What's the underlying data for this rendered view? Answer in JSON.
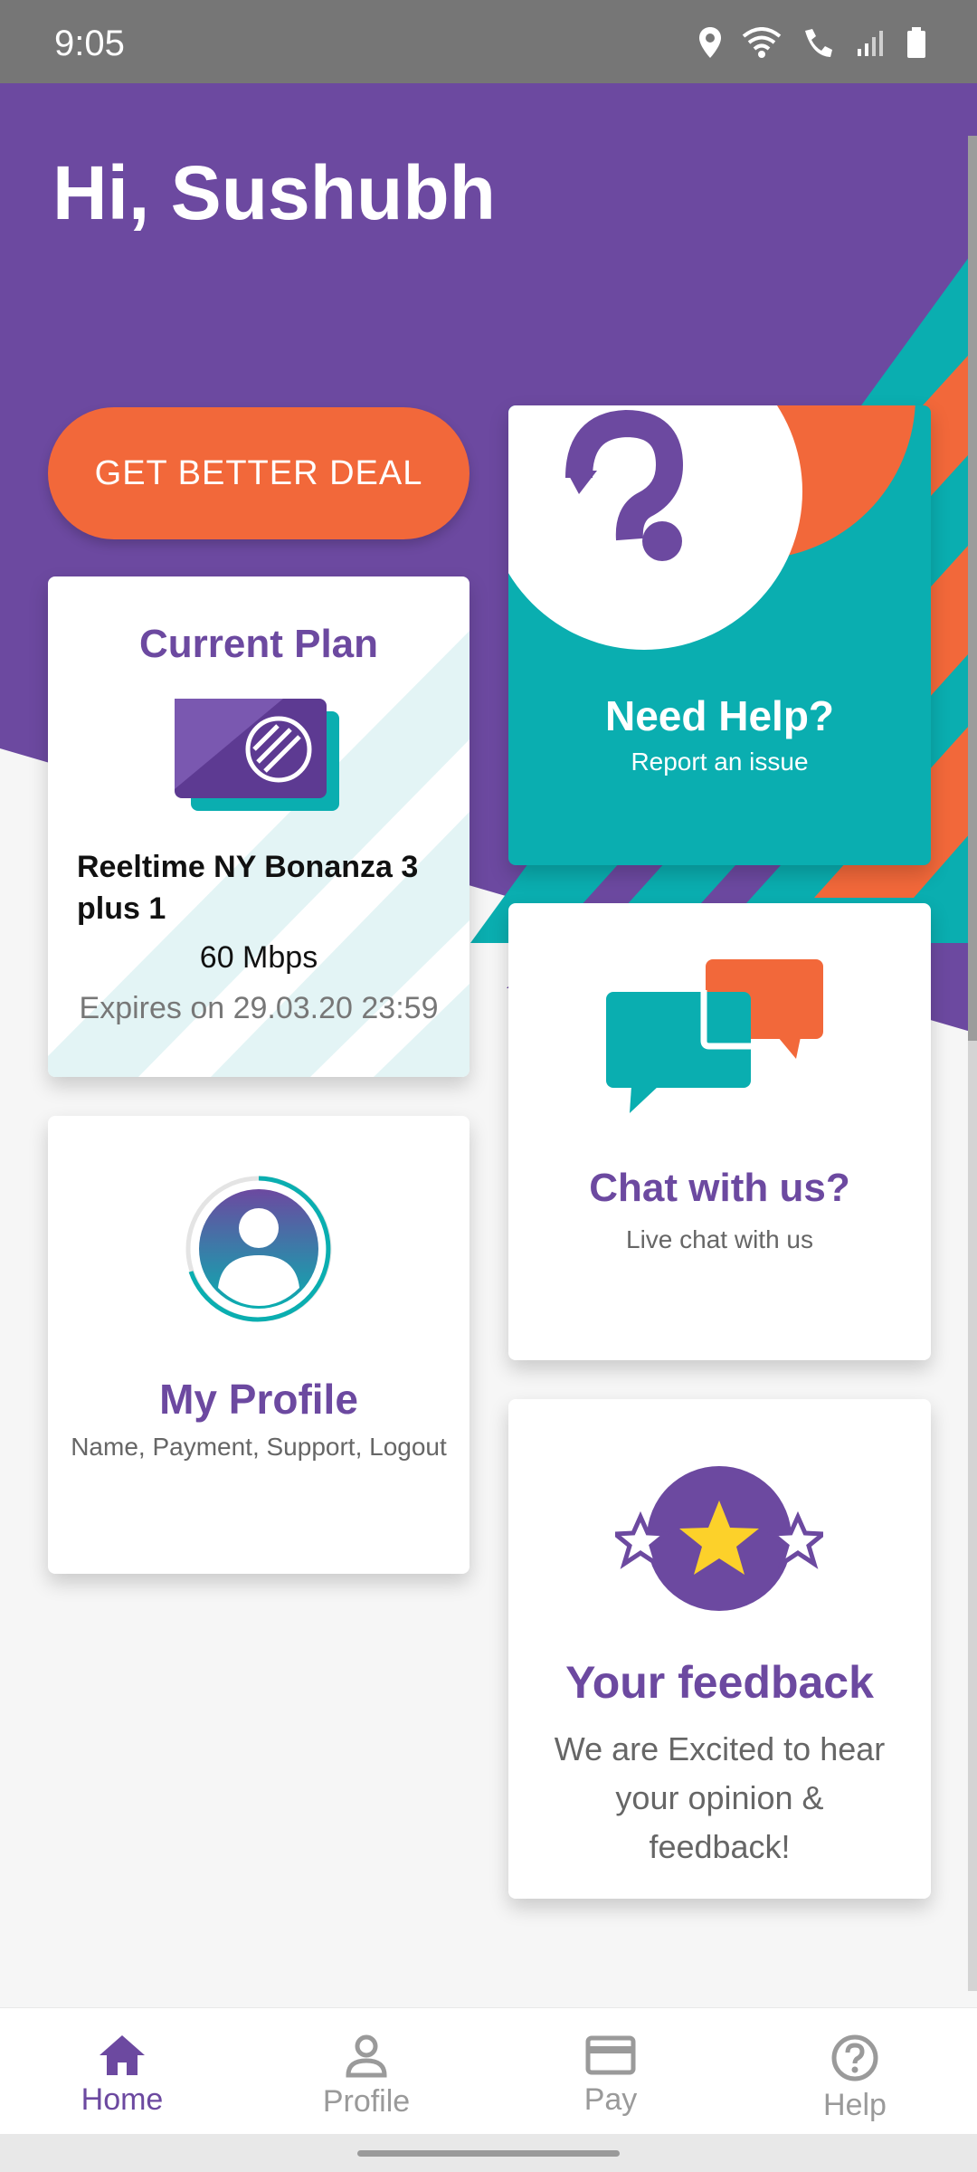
{
  "status_bar": {
    "time": "9:05"
  },
  "greeting": "Hi, Sushubh",
  "deal_button": "GET BETTER DEAL",
  "current_plan": {
    "title": "Current Plan",
    "plan_name": "Reeltime NY Bonanza 3 plus 1",
    "speed": "60 Mbps",
    "expiry": "Expires on 29.03.20 23:59"
  },
  "help_card": {
    "title": "Need Help?",
    "subtitle": "Report an issue"
  },
  "chat_card": {
    "title": "Chat with us?",
    "subtitle": "Live chat with us"
  },
  "profile_card": {
    "title": "My Profile",
    "subtitle": "Name, Payment, Support, Logout"
  },
  "feedback_card": {
    "title": "Your feedback",
    "subtitle": "We are Excited to hear your opinion & feedback!"
  },
  "bottom_nav": {
    "items": [
      {
        "label": "Home",
        "icon": "home-icon",
        "active": true
      },
      {
        "label": "Profile",
        "icon": "person-icon",
        "active": false
      },
      {
        "label": "Pay",
        "icon": "card-icon",
        "active": false
      },
      {
        "label": "Help",
        "icon": "help-icon",
        "active": false
      }
    ]
  },
  "colors": {
    "purple": "#6c49a0",
    "teal": "#0aaeb0",
    "orange": "#f2683a"
  }
}
